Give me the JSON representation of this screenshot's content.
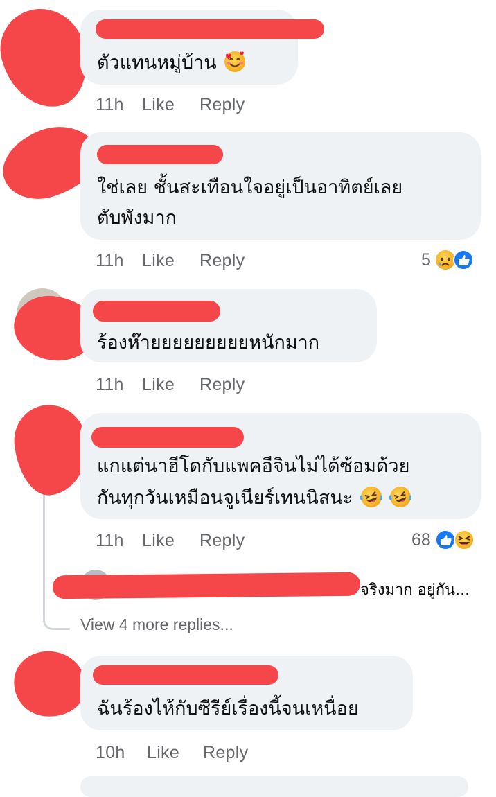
{
  "comments": [
    {
      "text_lines": [
        "ตัวแทนหมู่บ้าน"
      ],
      "emoji": [
        "smiling-face-with-hearts-icon"
      ],
      "time": "11h",
      "like": "Like",
      "reply": "Reply",
      "reaction_count": "",
      "reactions": []
    },
    {
      "text_lines": [
        "ใช่เลย ชั้นสะเทือนใจอยู่เป็นอาทิตย์เลย",
        "ตับพังมาก"
      ],
      "emoji": [],
      "time": "11h",
      "like": "Like",
      "reply": "Reply",
      "reaction_count": "5",
      "reactions": [
        "sad-reaction-icon",
        "like-reaction-icon"
      ]
    },
    {
      "text_lines": [
        "ร้องห๊ายยยยยยยยยหนักมาก"
      ],
      "emoji": [],
      "time": "11h",
      "like": "Like",
      "reply": "Reply",
      "reaction_count": "",
      "reactions": []
    },
    {
      "text_lines": [
        "แกแต่นาฮีโดกับแพคอีจินไม่ได้ซ้อมด้วย",
        "กันทุกวันเหมือนจูเนียร์เทนนิสนะ"
      ],
      "emoji": [
        "rolling-laughing-icon",
        "rolling-laughing-icon"
      ],
      "time": "11h",
      "like": "Like",
      "reply": "Reply",
      "reaction_count": "68",
      "reactions": [
        "like-reaction-icon",
        "haha-reaction-icon"
      ]
    },
    {
      "text_lines": [
        "ฉันร้องไห้กับซีรีย์เรื่องนี้จนเหนื่อย"
      ],
      "emoji": [],
      "time": "10h",
      "like": "Like",
      "reply": "Reply",
      "reaction_count": "",
      "reactions": []
    }
  ],
  "reply_preview": {
    "text": "จริงมาก อยู่กัน..."
  },
  "view_more_replies": "View 4 more replies...",
  "colors": {
    "bubble": "#eff2f5",
    "meta_text": "#65676b",
    "redaction": "#f5464a",
    "like_blue": "#1877f2",
    "emoji_yellow": "#f7c33c"
  }
}
